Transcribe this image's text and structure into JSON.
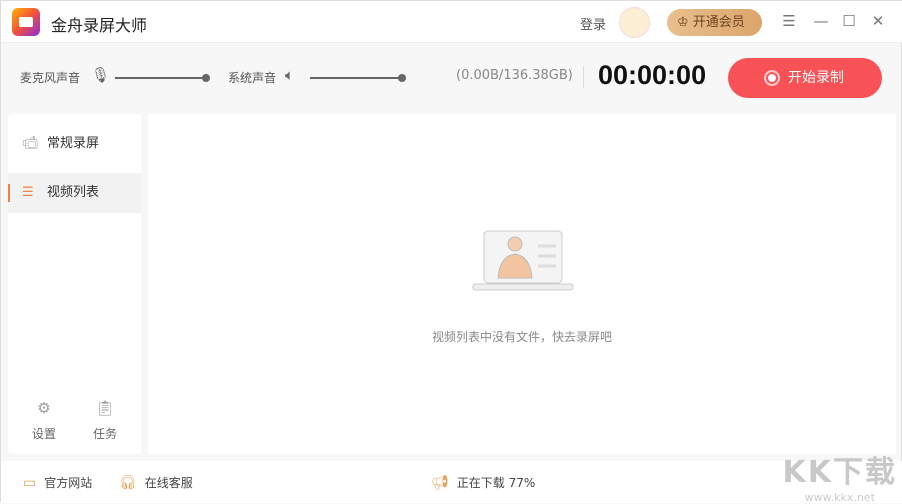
{
  "app": {
    "title": "金舟录屏大师",
    "login": "登录",
    "vip": "开通会员"
  },
  "toolbar": {
    "mic_label": "麦克风声音",
    "mic_volume": 1.0,
    "system_label": "系统声音",
    "system_volume": 1.0,
    "storage": "(0.00B/136.38GB)",
    "timer": "00:00:00",
    "record_label": "开始录制"
  },
  "sidebar": {
    "items": [
      {
        "label": "常规录屏"
      },
      {
        "label": "视频列表"
      }
    ],
    "settings": "设置",
    "tasks": "任务"
  },
  "main": {
    "empty_text": "视频列表中没有文件，快去录屏吧"
  },
  "footer": {
    "website": "官方网站",
    "support": "在线客服",
    "download_label": "正在下载",
    "download_progress": "77%"
  },
  "watermark": {
    "brand": "KK下载",
    "url": "www.kkx.net"
  }
}
